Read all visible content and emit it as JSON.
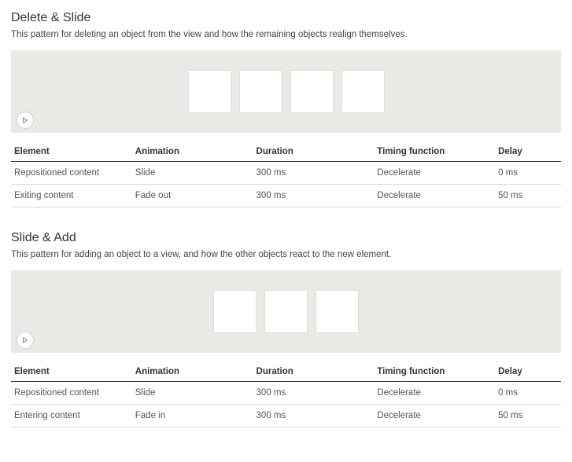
{
  "sections": [
    {
      "title": "Delete & Slide",
      "description": "This pattern for deleting an object from the view and how the remaining objects realign themselves.",
      "box_count": 4,
      "headers": {
        "element": "Element",
        "animation": "Animation",
        "duration": "Duration",
        "timing": "Timing function",
        "delay": "Delay"
      },
      "rows": [
        {
          "element": "Repositioned content",
          "animation": "Slide",
          "duration": "300 ms",
          "timing": "Decelerate",
          "delay": "0 ms"
        },
        {
          "element": "Exiting content",
          "animation": "Fade out",
          "duration": "300 ms",
          "timing": "Decelerate",
          "delay": "50 ms"
        }
      ]
    },
    {
      "title": "Slide & Add",
      "description": "This pattern for adding an object to a view, and how the other objects react to the new element.",
      "box_count": 3,
      "headers": {
        "element": "Element",
        "animation": "Animation",
        "duration": "Duration",
        "timing": "Timing function",
        "delay": "Delay"
      },
      "rows": [
        {
          "element": "Repositioned content",
          "animation": "Slide",
          "duration": "300 ms",
          "timing": "Decelerate",
          "delay": "0 ms"
        },
        {
          "element": "Entering content",
          "animation": "Fade in",
          "duration": "300 ms",
          "timing": "Decelerate",
          "delay": "50 ms"
        }
      ]
    }
  ]
}
